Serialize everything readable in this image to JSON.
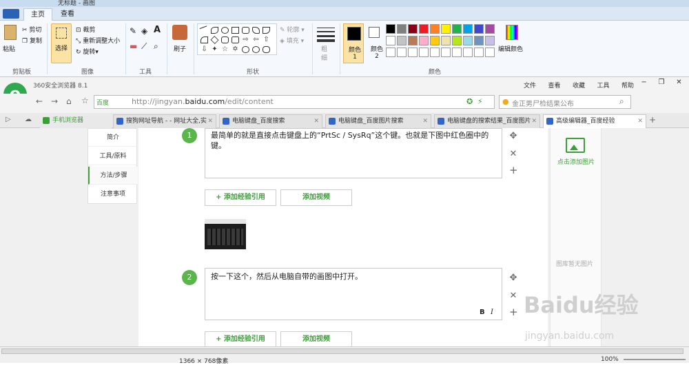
{
  "paint": {
    "title": "无标题 - 画图",
    "tabs": [
      "主页",
      "查看"
    ],
    "clipboard": {
      "paste": "粘贴",
      "cut": "剪切",
      "copy": "复制",
      "group": "剪贴板"
    },
    "image": {
      "select": "选择",
      "crop": "裁剪",
      "resize": "重新调整大小",
      "rotate": "旋转",
      "group": "图像"
    },
    "tools": {
      "group": "工具"
    },
    "brush": "刷子",
    "shapes": {
      "outline": "轮廓",
      "fill": "填充",
      "group": "形状"
    },
    "size": "粗细",
    "colors": {
      "color1": "颜色 1",
      "color2": "颜色 2",
      "edit": "编辑颜色",
      "group": "颜色",
      "palette": [
        "#000000",
        "#7f7f7f",
        "#880015",
        "#ed1c24",
        "#ff7f27",
        "#fff200",
        "#22b14c",
        "#00a2e8",
        "#3f48cc",
        "#a349a4",
        "#ffffff",
        "#c3c3c3",
        "#b97a57",
        "#ffaec9",
        "#ffc90e",
        "#efe4b0",
        "#b5e61d",
        "#99d9ea",
        "#7092be",
        "#c8bfe7"
      ]
    }
  },
  "browser": {
    "name": "360安全浏览器 8.1",
    "menu": [
      "文件",
      "查看",
      "收藏",
      "工具",
      "帮助"
    ],
    "engine": "百度",
    "url_prefix": "http://jingyan.",
    "url_domain": "baidu.com",
    "url_suffix": "/edit/content",
    "search_placeholder": "金正男尸检结果公布",
    "tabs": [
      {
        "label": "手机浏览器"
      },
      {
        "label": "搜狗网址导航 - - 网址大全,实"
      },
      {
        "label": "电脑键盘_百度搜索"
      },
      {
        "label": "电脑键盘_百度图片搜索"
      },
      {
        "label": "电脑键盘的搜索结果_百度图片"
      },
      {
        "label": "高级编辑器_百度经验"
      }
    ]
  },
  "page": {
    "nav": [
      "简介",
      "工具/原料",
      "方法/步骤",
      "注意事项"
    ],
    "steps": [
      {
        "num": "1",
        "text": "最简单的就是直接点击键盘上的“PrtSc / SysRq”这个键。也就是下图中红色圈中的键。"
      },
      {
        "num": "2",
        "text": "按一下这个，然后从电脑自带的画图中打开。"
      }
    ],
    "add_ref": "+ 添加经验引用",
    "add_video": "添加视频",
    "add_image": "点击添加图片",
    "no_image": "图库暂无图片",
    "watermark": "Baidu经验",
    "watermark_url": "jingyan.baidu.com"
  },
  "status": {
    "size": "1366 × 768像素",
    "zoom": "100%"
  }
}
